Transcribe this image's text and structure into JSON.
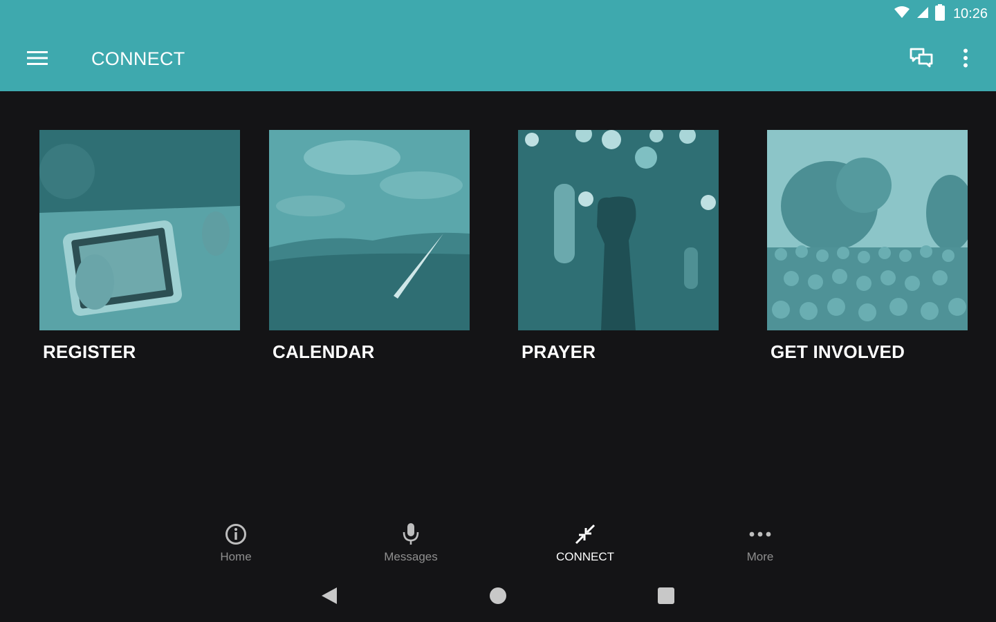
{
  "status_bar": {
    "time": "10:26",
    "icons": [
      "wifi-icon",
      "signal-icon",
      "battery-icon"
    ]
  },
  "app_bar": {
    "title": "CONNECT",
    "menu_icon": "hamburger-menu-icon",
    "chat_icon": "chat-bubbles-icon",
    "more_icon": "overflow-menu-icon"
  },
  "tiles": [
    {
      "label": "REGISTER"
    },
    {
      "label": "CALENDAR"
    },
    {
      "label": "PRAYER"
    },
    {
      "label": "GET INVOLVED"
    }
  ],
  "bottom_nav": {
    "items": [
      {
        "label": "Home",
        "icon": "info-circle-icon"
      },
      {
        "label": "Messages",
        "icon": "microphone-icon"
      },
      {
        "label": "CONNECT",
        "icon": "connect-arrows-icon",
        "active": true
      },
      {
        "label": "More",
        "icon": "dots-horizontal-icon"
      }
    ]
  },
  "colors": {
    "accent": "#3ea9ae",
    "background": "#141416",
    "tile_tint": "#3d8a90",
    "inactive_label": "#8f8f8f"
  }
}
